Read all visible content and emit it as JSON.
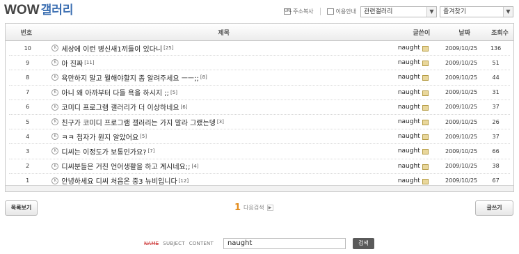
{
  "header": {
    "title_latin": "WOW",
    "title_korean": "갤러리"
  },
  "toolbar": {
    "copy_url": {
      "label": "주소복사",
      "icon": "url-icon",
      "icon_text": "URL"
    },
    "guide": {
      "label": "이용안내",
      "icon": "info-icon"
    },
    "related_gallery": {
      "value": "관련갤러리"
    },
    "favorites": {
      "value": "즐겨찾기"
    }
  },
  "table": {
    "columns": {
      "num": "번호",
      "subject": "제목",
      "writer": "글쓴이",
      "date": "날짜",
      "views": "조회수"
    },
    "rows": [
      {
        "num": "10",
        "subject": "세상에 이런 병신새1끼들이 있다니",
        "comments": "[25]",
        "writer": "naught",
        "date": "2009/10/25",
        "views": "136"
      },
      {
        "num": "9",
        "subject": "아 진짜",
        "comments": "[11]",
        "writer": "naught",
        "date": "2009/10/25",
        "views": "51"
      },
      {
        "num": "8",
        "subject": "욕만하지 말고 뭘해야할지 좀 알려주세요 ㅡㅡ;;",
        "comments": "[8]",
        "writer": "naught",
        "date": "2009/10/25",
        "views": "44"
      },
      {
        "num": "7",
        "subject": "아니 왜 아까부터 다들 욕을 하시지 ;;",
        "comments": "[5]",
        "writer": "naught",
        "date": "2009/10/25",
        "views": "31"
      },
      {
        "num": "6",
        "subject": "코미디 프로그램 갤러리가 더 이상하네요",
        "comments": "[6]",
        "writer": "naught",
        "date": "2009/10/25",
        "views": "37"
      },
      {
        "num": "5",
        "subject": "친구가 코미디 프로그램 갤러리는 가지 말라 그랬는뎅",
        "comments": "[3]",
        "writer": "naught",
        "date": "2009/10/25",
        "views": "26"
      },
      {
        "num": "4",
        "subject": "ㅋㅋ 첩자가 뭔지 알았어요",
        "comments": "[5]",
        "writer": "naught",
        "date": "2009/10/25",
        "views": "37"
      },
      {
        "num": "3",
        "subject": "디씨는 이정도가 보통인가요?",
        "comments": "[7]",
        "writer": "naught",
        "date": "2009/10/25",
        "views": "66"
      },
      {
        "num": "2",
        "subject": "디씨분들은 거친 언어생활을 하고 계시네요;;",
        "comments": "[4]",
        "writer": "naught",
        "date": "2009/10/25",
        "views": "38"
      },
      {
        "num": "1",
        "subject": "안녕하세요 디씨 처음온 중3 뉴비입니다",
        "comments": "[12]",
        "writer": "naught",
        "date": "2009/10/25",
        "views": "67"
      }
    ]
  },
  "buttons": {
    "list": "목록보기",
    "write": "글쓰기"
  },
  "pagination": {
    "current": "1",
    "next_search": "다음검색"
  },
  "search": {
    "options": {
      "name": "NAME",
      "subject": "SUBJECT",
      "content": "CONTENT"
    },
    "query": "naught",
    "button": "검색"
  },
  "colors": {
    "title_blue": "#3c6fb2",
    "page_orange": "#e38c1b"
  }
}
